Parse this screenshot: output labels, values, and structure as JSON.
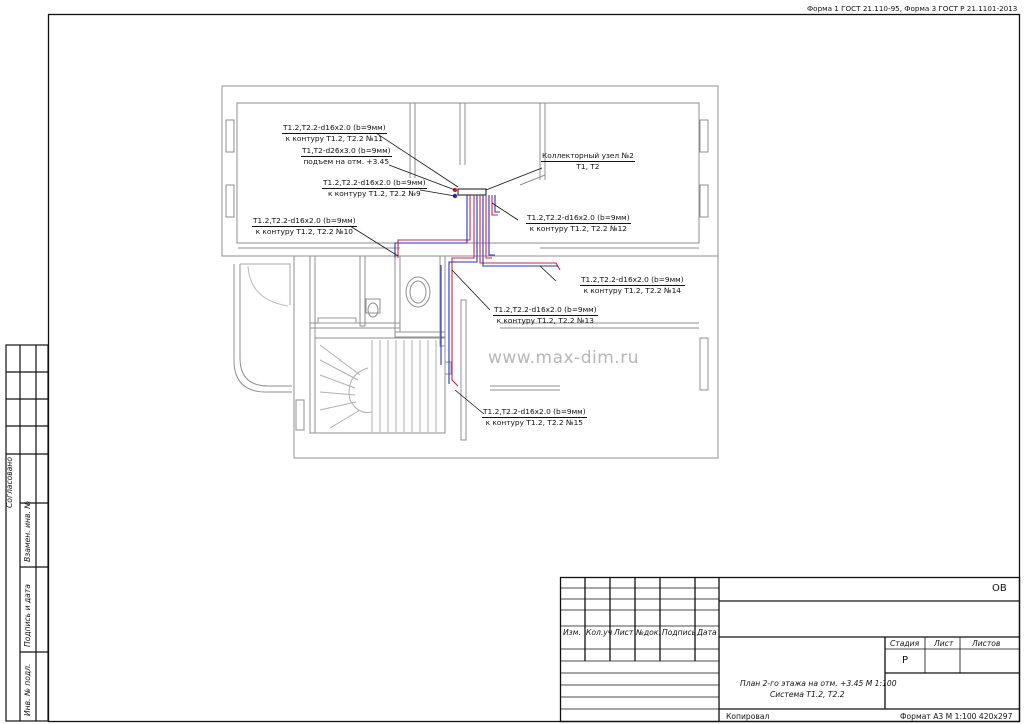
{
  "header": {
    "form_note": "Форма 1 ГОСТ 21.110-95, Форма 3 ГОСТ Р 21.1101-2013"
  },
  "watermark": "www.max-dim.ru",
  "callouts": [
    {
      "id": "c11",
      "line1": "T1.2,T2.2-d16x2.0 (b=9мм)",
      "line2": "к контуру T1.2, T2.2 №11"
    },
    {
      "id": "c345",
      "line1": "T1,T2-d26x3.0 (b=9мм)",
      "line2": "подъем на отм. +3.45"
    },
    {
      "id": "c9",
      "line1": "T1.2,T2.2-d16x2.0 (b=9мм)",
      "line2": "к контуру T1.2, T2.2 №9"
    },
    {
      "id": "c10",
      "line1": "T1.2,T2.2-d16x2.0 (b=9мм)",
      "line2": "к контуру T1.2, T2.2 №10"
    },
    {
      "id": "ck",
      "line1": "Коллекторный узел №2",
      "line2": "T1, T2"
    },
    {
      "id": "c12",
      "line1": "T1.2,T2.2-d16x2.0 (b=9мм)",
      "line2": "к контуру T1.2, T2.2 №12"
    },
    {
      "id": "c14",
      "line1": "T1.2,T2.2-d16x2.0 (b=9мм)",
      "line2": "к контуру T1.2, T2.2 №14"
    },
    {
      "id": "c13",
      "line1": "T1.2,T2.2-d16x2.0 (b=9мм)",
      "line2": "к контуру T1.2, T2.2 №13"
    },
    {
      "id": "c15",
      "line1": "T1.2,T2.2-d16x2.0 (b=9мм)",
      "line2": "к контуру T1.2, T2.2 №15"
    }
  ],
  "left_strip": {
    "approved": "Согласовано",
    "replace_inv": "Взамен. инв. №",
    "sign_date": "Подпись и дата",
    "inv_orig": "Инв. № подл."
  },
  "title_block": {
    "code": "ОВ",
    "cols": [
      "Изм.",
      "Кол.уч",
      "Лист",
      "№док.",
      "Подпись",
      "Дата"
    ],
    "stage_head": "Стадия",
    "sheet_head": "Лист",
    "sheets_head": "Листов",
    "stage_value": "Р",
    "description_line1": "План 2-го этажа на отм. +3.45 М 1:100",
    "description_line2": "Система T1.2, T2.2",
    "copied": "Копировал",
    "format": "Формат А3 М 1:100 420х297"
  },
  "colors": {
    "supply": "#d0204a",
    "return": "#2233c8",
    "ink": "#111111",
    "wall": "#9a9a9a"
  }
}
